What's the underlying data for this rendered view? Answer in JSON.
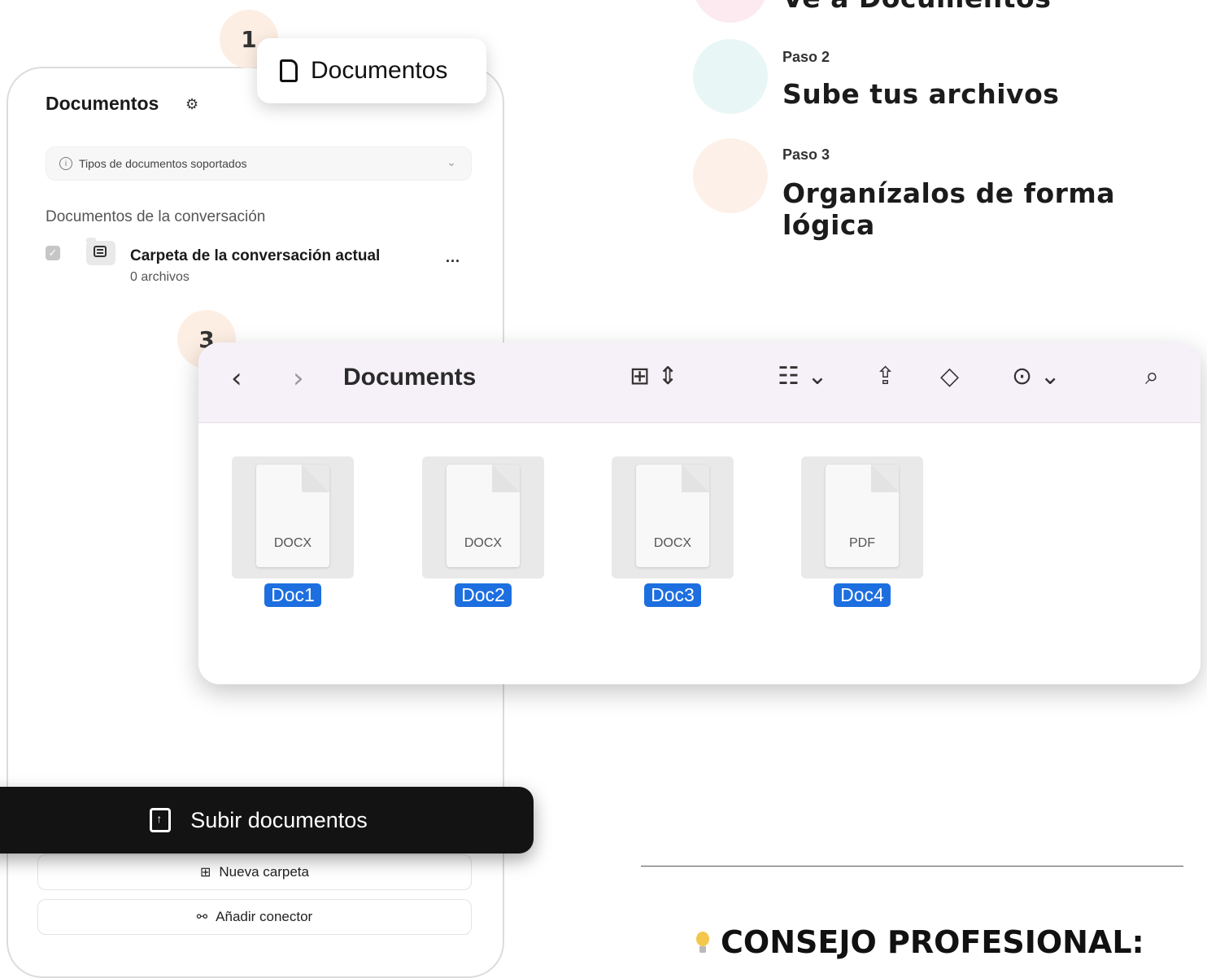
{
  "steps": {
    "step1_title": "Ve a Documentos",
    "step2_kicker": "Paso 2",
    "step2_title": "Sube tus archivos",
    "step3_kicker": "Paso 3",
    "step3_title": "Organízalos de forma lógica"
  },
  "badges": {
    "one": "1",
    "three": "3"
  },
  "callout": {
    "label": "Documentos"
  },
  "panel": {
    "title": "Documentos",
    "doc_types": "Tipos de documentos soportados",
    "section_label": "Documentos de la conversación",
    "folder_name": "Carpeta de la conversación actual",
    "folder_count": "0 archivos",
    "more": "...",
    "new_folder": "Nueva carpeta",
    "add_connector": "Añadir conector"
  },
  "upload": {
    "label": "Subir documentos"
  },
  "finder": {
    "title": "Documents",
    "files": [
      {
        "name": "Doc1",
        "ext": "DOCX"
      },
      {
        "name": "Doc2",
        "ext": "DOCX"
      },
      {
        "name": "Doc3",
        "ext": "DOCX"
      },
      {
        "name": "Doc4",
        "ext": "PDF"
      }
    ],
    "icons": [
      "back-chevron",
      "forward-chevron",
      "grid-view",
      "group-view",
      "share",
      "tag",
      "more-actions",
      "search"
    ]
  },
  "tip": {
    "label": "CONSEJO PROFESIONAL:"
  },
  "colors": {
    "accent_blue": "#1d6fe0",
    "upload_bar": "#131313",
    "toolbar_bg": "#f6f1f8"
  }
}
